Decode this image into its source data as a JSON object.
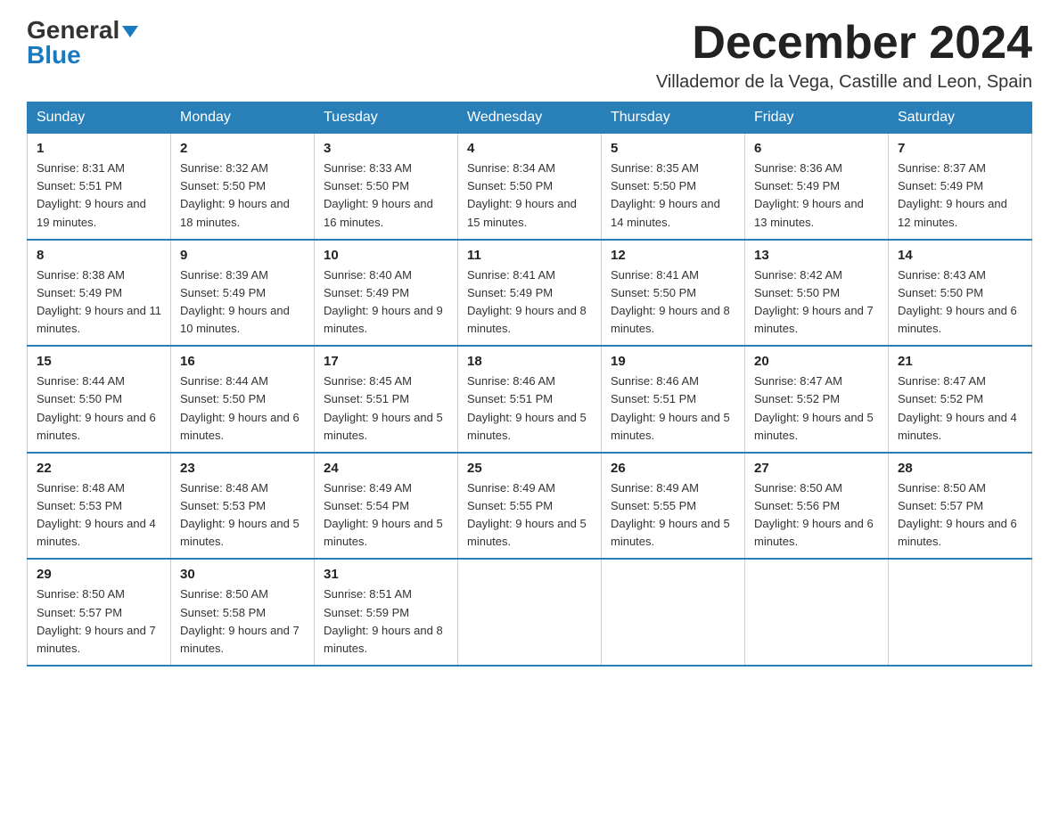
{
  "header": {
    "logo_line1": "General",
    "logo_line2": "Blue",
    "month_title": "December 2024",
    "subtitle": "Villademor de la Vega, Castille and Leon, Spain"
  },
  "weekdays": [
    "Sunday",
    "Monday",
    "Tuesday",
    "Wednesday",
    "Thursday",
    "Friday",
    "Saturday"
  ],
  "weeks": [
    [
      {
        "day": "1",
        "sunrise": "8:31 AM",
        "sunset": "5:51 PM",
        "daylight": "9 hours and 19 minutes."
      },
      {
        "day": "2",
        "sunrise": "8:32 AM",
        "sunset": "5:50 PM",
        "daylight": "9 hours and 18 minutes."
      },
      {
        "day": "3",
        "sunrise": "8:33 AM",
        "sunset": "5:50 PM",
        "daylight": "9 hours and 16 minutes."
      },
      {
        "day": "4",
        "sunrise": "8:34 AM",
        "sunset": "5:50 PM",
        "daylight": "9 hours and 15 minutes."
      },
      {
        "day": "5",
        "sunrise": "8:35 AM",
        "sunset": "5:50 PM",
        "daylight": "9 hours and 14 minutes."
      },
      {
        "day": "6",
        "sunrise": "8:36 AM",
        "sunset": "5:49 PM",
        "daylight": "9 hours and 13 minutes."
      },
      {
        "day": "7",
        "sunrise": "8:37 AM",
        "sunset": "5:49 PM",
        "daylight": "9 hours and 12 minutes."
      }
    ],
    [
      {
        "day": "8",
        "sunrise": "8:38 AM",
        "sunset": "5:49 PM",
        "daylight": "9 hours and 11 minutes."
      },
      {
        "day": "9",
        "sunrise": "8:39 AM",
        "sunset": "5:49 PM",
        "daylight": "9 hours and 10 minutes."
      },
      {
        "day": "10",
        "sunrise": "8:40 AM",
        "sunset": "5:49 PM",
        "daylight": "9 hours and 9 minutes."
      },
      {
        "day": "11",
        "sunrise": "8:41 AM",
        "sunset": "5:49 PM",
        "daylight": "9 hours and 8 minutes."
      },
      {
        "day": "12",
        "sunrise": "8:41 AM",
        "sunset": "5:50 PM",
        "daylight": "9 hours and 8 minutes."
      },
      {
        "day": "13",
        "sunrise": "8:42 AM",
        "sunset": "5:50 PM",
        "daylight": "9 hours and 7 minutes."
      },
      {
        "day": "14",
        "sunrise": "8:43 AM",
        "sunset": "5:50 PM",
        "daylight": "9 hours and 6 minutes."
      }
    ],
    [
      {
        "day": "15",
        "sunrise": "8:44 AM",
        "sunset": "5:50 PM",
        "daylight": "9 hours and 6 minutes."
      },
      {
        "day": "16",
        "sunrise": "8:44 AM",
        "sunset": "5:50 PM",
        "daylight": "9 hours and 6 minutes."
      },
      {
        "day": "17",
        "sunrise": "8:45 AM",
        "sunset": "5:51 PM",
        "daylight": "9 hours and 5 minutes."
      },
      {
        "day": "18",
        "sunrise": "8:46 AM",
        "sunset": "5:51 PM",
        "daylight": "9 hours and 5 minutes."
      },
      {
        "day": "19",
        "sunrise": "8:46 AM",
        "sunset": "5:51 PM",
        "daylight": "9 hours and 5 minutes."
      },
      {
        "day": "20",
        "sunrise": "8:47 AM",
        "sunset": "5:52 PM",
        "daylight": "9 hours and 5 minutes."
      },
      {
        "day": "21",
        "sunrise": "8:47 AM",
        "sunset": "5:52 PM",
        "daylight": "9 hours and 4 minutes."
      }
    ],
    [
      {
        "day": "22",
        "sunrise": "8:48 AM",
        "sunset": "5:53 PM",
        "daylight": "9 hours and 4 minutes."
      },
      {
        "day": "23",
        "sunrise": "8:48 AM",
        "sunset": "5:53 PM",
        "daylight": "9 hours and 5 minutes."
      },
      {
        "day": "24",
        "sunrise": "8:49 AM",
        "sunset": "5:54 PM",
        "daylight": "9 hours and 5 minutes."
      },
      {
        "day": "25",
        "sunrise": "8:49 AM",
        "sunset": "5:55 PM",
        "daylight": "9 hours and 5 minutes."
      },
      {
        "day": "26",
        "sunrise": "8:49 AM",
        "sunset": "5:55 PM",
        "daylight": "9 hours and 5 minutes."
      },
      {
        "day": "27",
        "sunrise": "8:50 AM",
        "sunset": "5:56 PM",
        "daylight": "9 hours and 6 minutes."
      },
      {
        "day": "28",
        "sunrise": "8:50 AM",
        "sunset": "5:57 PM",
        "daylight": "9 hours and 6 minutes."
      }
    ],
    [
      {
        "day": "29",
        "sunrise": "8:50 AM",
        "sunset": "5:57 PM",
        "daylight": "9 hours and 7 minutes."
      },
      {
        "day": "30",
        "sunrise": "8:50 AM",
        "sunset": "5:58 PM",
        "daylight": "9 hours and 7 minutes."
      },
      {
        "day": "31",
        "sunrise": "8:51 AM",
        "sunset": "5:59 PM",
        "daylight": "9 hours and 8 minutes."
      },
      null,
      null,
      null,
      null
    ]
  ]
}
